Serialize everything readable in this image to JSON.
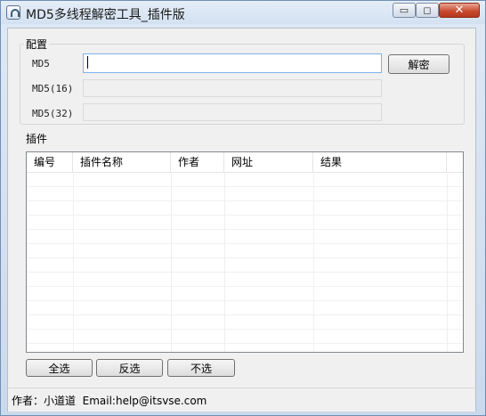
{
  "window": {
    "title": "MD5多线程解密工具_插件版",
    "controls": {
      "minimize": "▭",
      "maximize": "◻",
      "close": "✕"
    }
  },
  "config": {
    "group_label": "配置",
    "md5_label": "MD5",
    "md5_value": "",
    "md5_16_label": "MD5(16)",
    "md5_16_value": "",
    "md5_32_label": "MD5(32)",
    "md5_32_value": "",
    "decrypt_button": "解密"
  },
  "plugins": {
    "group_label": "插件",
    "columns": [
      "编号",
      "插件名称",
      "作者",
      "网址",
      "结果"
    ],
    "rows": [],
    "buttons": {
      "select_all": "全选",
      "invert": "反选",
      "select_none": "不选"
    }
  },
  "status": {
    "text": "作者：小道道  Email:help@itsvse.com"
  },
  "colors": {
    "title_gradient": "#dfe9f5",
    "close_button": "#c7462b",
    "input_focus_border": "#7eb4ea"
  }
}
